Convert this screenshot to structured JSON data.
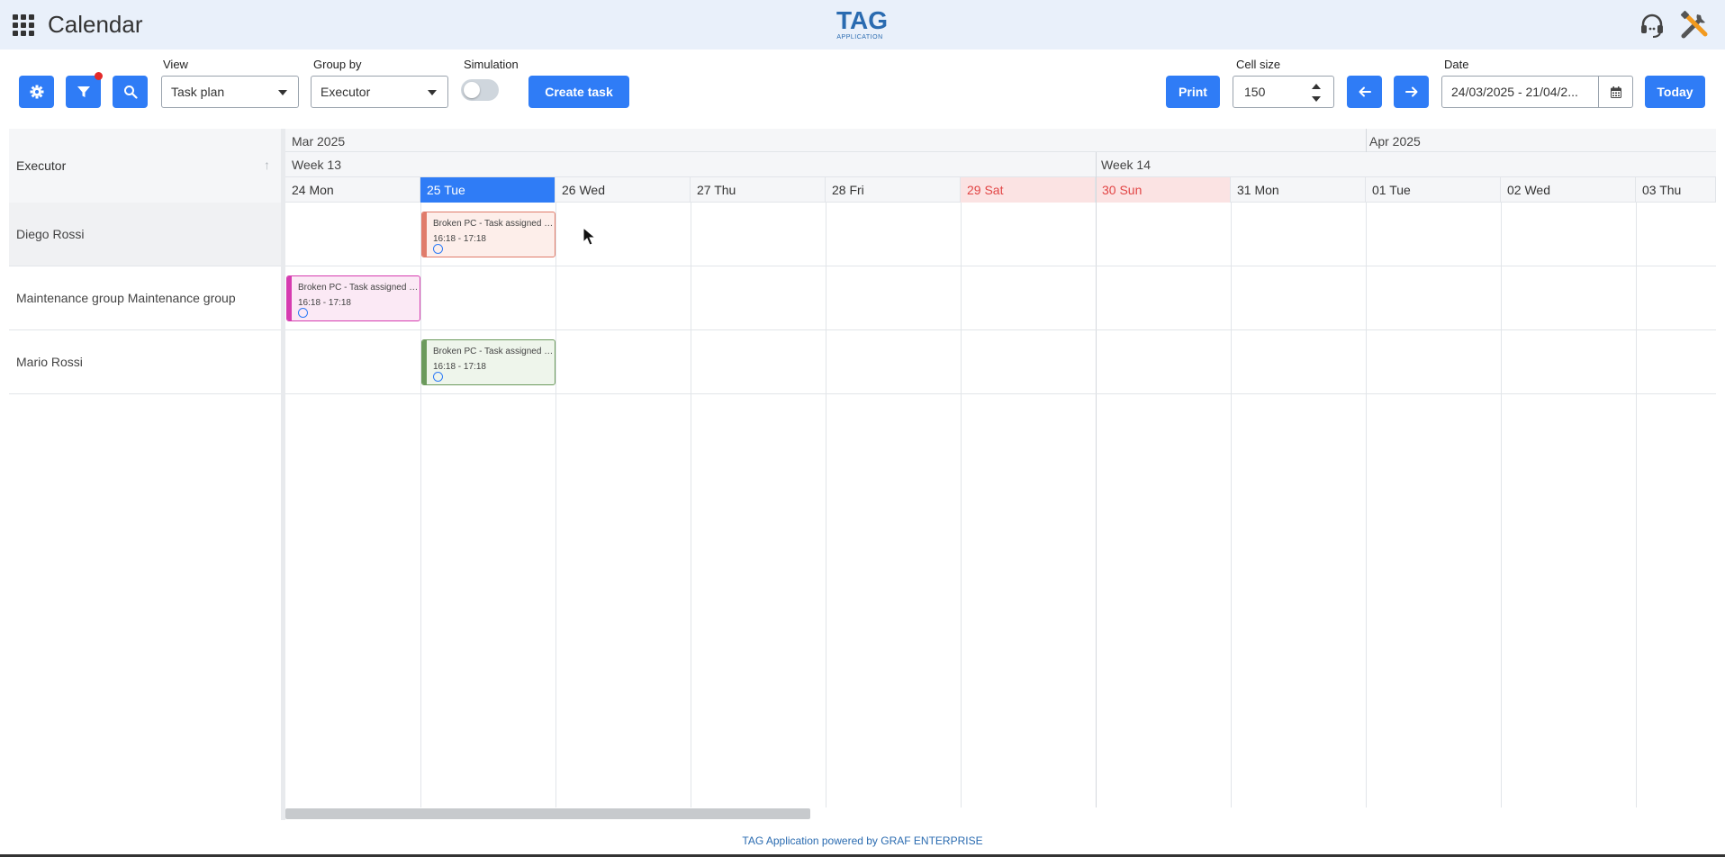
{
  "header": {
    "title": "Calendar",
    "logo_big": "TAG",
    "logo_small": "APPLICATION",
    "apps_icon": "apps-grid-icon",
    "support_icon": "headset-icon",
    "tools_icon": "tools-icon"
  },
  "toolbar": {
    "view_label": "View",
    "view_value": "Task plan",
    "groupby_label": "Group by",
    "groupby_value": "Executor",
    "simulation_label": "Simulation",
    "simulation_on": false,
    "create_task_label": "Create task",
    "print_label": "Print",
    "cell_size_label": "Cell size",
    "cell_size_value": "150",
    "date_label": "Date",
    "date_value": "24/03/2025 - 21/04/2...",
    "today_label": "Today",
    "accent_color": "#2f7cf6",
    "filter_badge_color": "#e32a2a"
  },
  "grid": {
    "executor_header": "Executor",
    "months": [
      "Mar 2025",
      "Apr 2025"
    ],
    "weeks": [
      "Week 13",
      "Week 14"
    ],
    "days": [
      {
        "label": "24 Mon",
        "type": "normal"
      },
      {
        "label": "25 Tue",
        "type": "today"
      },
      {
        "label": "26 Wed",
        "type": "normal"
      },
      {
        "label": "27 Thu",
        "type": "normal"
      },
      {
        "label": "28 Fri",
        "type": "normal"
      },
      {
        "label": "29 Sat",
        "type": "weekend"
      },
      {
        "label": "30 Sun",
        "type": "weekend"
      },
      {
        "label": "31 Mon",
        "type": "normal"
      },
      {
        "label": "01 Tue",
        "type": "normal"
      },
      {
        "label": "02 Wed",
        "type": "normal"
      },
      {
        "label": "03 Thu",
        "type": "normal"
      }
    ],
    "executors": [
      "Diego Rossi",
      "Maintenance group Maintenance group",
      "Mario Rossi"
    ],
    "events": [
      {
        "title": "Broken PC - Task assigned to Diego Rossi",
        "time": "16:18 - 17:18",
        "executor_index": 0,
        "day_index": 1,
        "color": "#e07b6a",
        "bg": "#fdeeea"
      },
      {
        "title": "Broken PC - Task assigned to Maintenance group",
        "time": "16:18 - 17:18",
        "executor_index": 1,
        "day_index": 0,
        "color": "#d63cb0",
        "bg": "#fbe9f5"
      },
      {
        "title": "Broken PC - Task assigned to Mario Rossi",
        "time": "16:18 - 17:18",
        "executor_index": 2,
        "day_index": 1,
        "color": "#6b9a5c",
        "bg": "#eef5eb"
      }
    ]
  },
  "footer": {
    "text": "TAG Application powered by GRAF ENTERPRISE"
  }
}
